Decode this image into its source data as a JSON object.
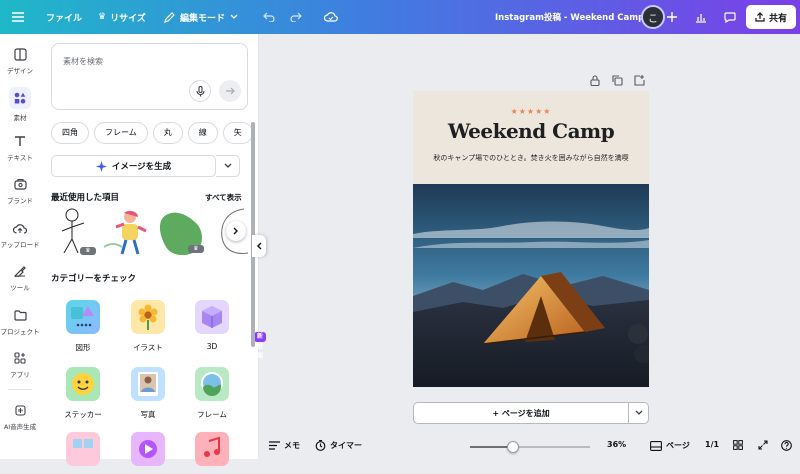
{
  "topbar": {
    "file_label": "ファイル",
    "resize_label": "リサイズ",
    "edit_mode_label": "編集モード",
    "doc_title": "Instagram投稿 - Weekend Camp",
    "avatar_initial": "こ",
    "share_label": "共有"
  },
  "rail": [
    {
      "label": "デザイン",
      "icon": "design-icon"
    },
    {
      "label": "素材",
      "icon": "elements-icon"
    },
    {
      "label": "テキスト",
      "icon": "text-icon"
    },
    {
      "label": "ブランド",
      "icon": "brand-icon"
    },
    {
      "label": "アップロード",
      "icon": "upload-icon"
    },
    {
      "label": "ツール",
      "icon": "tools-icon"
    },
    {
      "label": "プロジェクト",
      "icon": "folder-icon"
    },
    {
      "label": "アプリ",
      "icon": "apps-icon"
    },
    {
      "label": "AI音声生成",
      "icon": "ai-voice-icon"
    }
  ],
  "panel": {
    "search_placeholder": "素材を検索",
    "chips": [
      "四角",
      "フレーム",
      "丸",
      "線",
      "矢"
    ],
    "generate_label": "イメージを生成",
    "recent_title": "最近使用した項目",
    "see_all": "すべて表示",
    "categories_title": "カテゴリーをチェック",
    "categories": [
      {
        "label": "図形"
      },
      {
        "label": "イラスト"
      },
      {
        "label": "3D"
      },
      {
        "label": "ステッカー"
      },
      {
        "label": "写真"
      },
      {
        "label": "フレーム"
      }
    ],
    "new_badge": "新登場"
  },
  "design": {
    "stars": "★★★★★",
    "headline": "Weekend Camp",
    "subtitle": "秋のキャンプ場でのひととき。焚き火を囲みながら自然を満喫"
  },
  "canvas": {
    "add_page_label": "+ ページを追加"
  },
  "bottombar": {
    "notes_label": "メモ",
    "timer_label": "タイマー",
    "zoom": "36%",
    "zoom_fraction": 0.36,
    "pages_label": "ページ",
    "page_count": "1/1"
  },
  "colors": {
    "accent": "#8b3dff",
    "star": "#e98657"
  }
}
